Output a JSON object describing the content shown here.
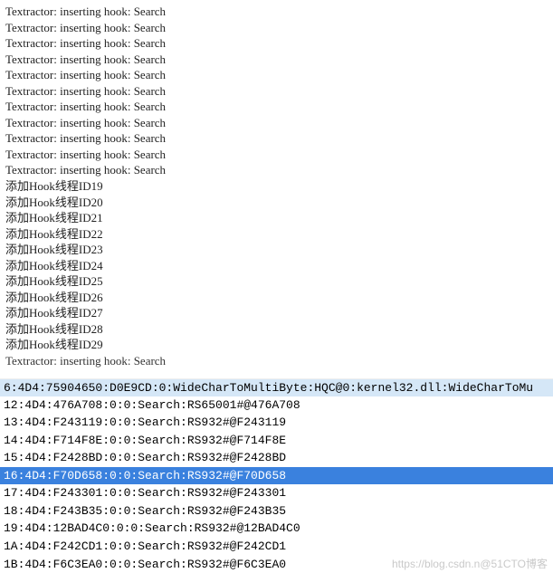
{
  "log": {
    "hook_lines": [
      "Textractor: inserting hook: Search",
      "Textractor: inserting hook: Search",
      "Textractor: inserting hook: Search",
      "Textractor: inserting hook: Search",
      "Textractor: inserting hook: Search",
      "Textractor: inserting hook: Search",
      "Textractor: inserting hook: Search",
      "Textractor: inserting hook: Search",
      "Textractor: inserting hook: Search",
      "Textractor: inserting hook: Search",
      "Textractor: inserting hook: Search"
    ],
    "thread_add_lines": [
      "添加Hook线程ID19",
      "添加Hook线程ID20",
      "添加Hook线程ID21",
      "添加Hook线程ID22",
      "添加Hook线程ID23",
      "添加Hook线程ID24",
      "添加Hook线程ID25",
      "添加Hook线程ID26",
      "添加Hook线程ID27",
      "添加Hook线程ID28",
      "添加Hook线程ID29"
    ],
    "truncated_line": "Textractor: inserting hook: Search"
  },
  "threads": {
    "header": "6:4D4:75904650:D0E9CD:0:WideCharToMultiByte:HQC@0:kernel32.dll:WideCharToMu",
    "items": [
      {
        "text": "12:4D4:476A708:0:0:Search:RS65001#@476A708",
        "selected": false
      },
      {
        "text": "13:4D4:F243119:0:0:Search:RS932#@F243119",
        "selected": false
      },
      {
        "text": "14:4D4:F714F8E:0:0:Search:RS932#@F714F8E",
        "selected": false
      },
      {
        "text": "15:4D4:F2428BD:0:0:Search:RS932#@F2428BD",
        "selected": false
      },
      {
        "text": "16:4D4:F70D658:0:0:Search:RS932#@F70D658",
        "selected": true
      },
      {
        "text": "17:4D4:F243301:0:0:Search:RS932#@F243301",
        "selected": false
      },
      {
        "text": "18:4D4:F243B35:0:0:Search:RS932#@F243B35",
        "selected": false
      },
      {
        "text": "19:4D4:12BAD4C0:0:0:Search:RS932#@12BAD4C0",
        "selected": false
      },
      {
        "text": "1A:4D4:F242CD1:0:0:Search:RS932#@F242CD1",
        "selected": false
      },
      {
        "text": "1B:4D4:F6C3EA0:0:0:Search:RS932#@F6C3EA0",
        "selected": false
      }
    ]
  },
  "watermark": "https://blog.csdn.n@51CTO博客"
}
